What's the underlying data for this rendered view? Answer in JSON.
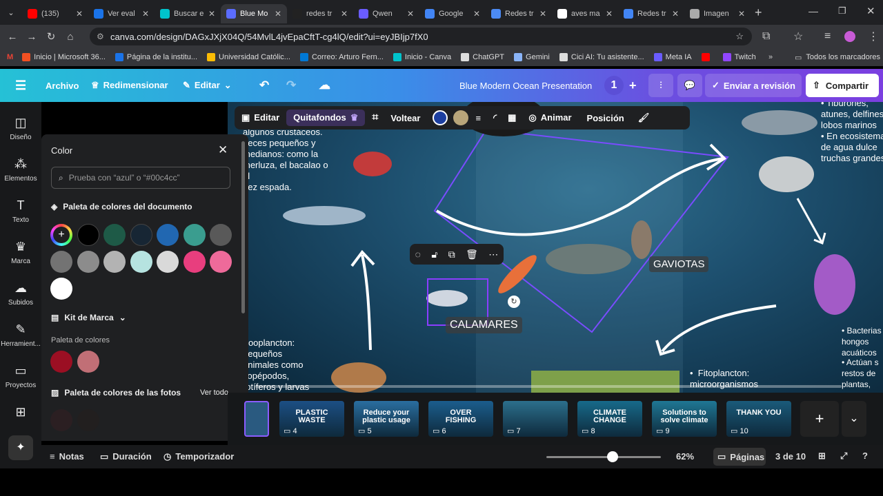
{
  "tabs": [
    {
      "label": "(135)",
      "color": "#ff0000"
    },
    {
      "label": "Ver eval",
      "color": "#1a73e8"
    },
    {
      "label": "Buscar e",
      "color": "#00c4cc"
    },
    {
      "label": "Blue Mo",
      "color": "#5b6cff"
    },
    {
      "label": "redes tr",
      "color": "#222"
    },
    {
      "label": "Qwen",
      "color": "#6a5cff"
    },
    {
      "label": "Google",
      "color": "#4285f4"
    },
    {
      "label": "Redes tr",
      "color": "#4c8bf5"
    },
    {
      "label": "aves ma",
      "color": "#fff"
    },
    {
      "label": "Redes tr",
      "color": "#4285f4"
    },
    {
      "label": "Imagen",
      "color": "#aaa"
    }
  ],
  "url": "canva.com/design/DAGxJXjX04Q/54MvlL4jvEpaCftT-cg4lQ/edit?ui=eyJBIjp7fX0",
  "bookmarks": [
    {
      "label": "Inicio | Microsoft 36...",
      "color": "#f25022"
    },
    {
      "label": "Página de la institu...",
      "color": "#1a73e8"
    },
    {
      "label": "Universidad Católic...",
      "color": "#fbbc05"
    },
    {
      "label": "Correo: Arturo Fern...",
      "color": "#0078d4"
    },
    {
      "label": "Inicio - Canva",
      "color": "#00c4cc"
    },
    {
      "label": "ChatGPT",
      "color": "#ddd"
    },
    {
      "label": "Gemini",
      "color": "#8ab4f8"
    },
    {
      "label": "Cici AI: Tu asistente...",
      "color": "#ddd"
    },
    {
      "label": "Meta IA",
      "color": "#6a5cff"
    },
    {
      "label": "",
      "color": "#ff0000"
    },
    {
      "label": "Twitch",
      "color": "#9146ff"
    }
  ],
  "bookmarks_all": "Todos los marcadores",
  "canva": {
    "archivo": "Archivo",
    "redimensionar": "Redimensionar",
    "editar": "Editar",
    "title": "Blue Modern Ocean Presentation",
    "collab_count": "1",
    "enviar": "Enviar a revisión",
    "compartir": "Compartir"
  },
  "sidebar": [
    {
      "label": "Diseño",
      "icon": "layout-icon"
    },
    {
      "label": "Elementos",
      "icon": "elements-icon"
    },
    {
      "label": "Texto",
      "icon": "text-icon"
    },
    {
      "label": "Marca",
      "icon": "brand-icon"
    },
    {
      "label": "Subidos",
      "icon": "upload-icon"
    },
    {
      "label": "Herramient...",
      "icon": "tools-icon"
    },
    {
      "label": "Proyectos",
      "icon": "folder-icon"
    }
  ],
  "color_panel": {
    "title": "Color",
    "search_placeholder": "Prueba con “azul” o “#00c4cc”",
    "doc_palette": "Paleta de colores del documento",
    "doc_colors": [
      "#000000",
      "#1e5a47",
      "#172634",
      "#2167b1",
      "#3a9d8f",
      "#595959",
      "#737373",
      "#8c8c8c",
      "#b3b3b3",
      "#b6e3e0",
      "#d9d9d9",
      "#e83e7e",
      "#ee6a9a",
      "#ffffff"
    ],
    "brand_kit": "Kit de Marca",
    "brand_palette": "Paleta de colores",
    "brand_colors": [
      "#9b0f23",
      "#c16f76"
    ],
    "photo_palette": "Paleta de colores de las fotos",
    "ver_todo": "Ver todo",
    "photo_colors": [
      "#2b1f22",
      "#221f1f"
    ]
  },
  "toolbar": {
    "editar": "Editar",
    "quitafondos": "Quitafondos",
    "voltear": "Voltear",
    "color1": "#1d3fa0",
    "color2": "#b8a57a",
    "animar": "Animar",
    "posicion": "Posición"
  },
  "slide": {
    "top_left_text": "algunos crustáceos.\npeces pequeños y\nmedianos: como la\nmerluza, el bacalao o el\npez espada.",
    "top_right_text": "Tiburones,\natunes, delfines\nlobos marinos",
    "right_text2": "En ecosistemas\nde agua dulce\ntruchas grandes",
    "gaviotas": "GAVIOTAS",
    "calamares": "CALAMARES",
    "zooplancton": "Zooplancton:\npequeños\nanimales como\ncopépodos,\nrotíferos y larvas",
    "fitoplancton": "Fitoplancton:\nmicroorganismos",
    "bacterias": "Bacterias\nhongos\nacuáticos",
    "actuan": "Actúan s\nrestos de\nplantas,"
  },
  "thumbs": [
    {
      "n": "4",
      "text": "PLASTIC WASTE",
      "bg": "#1c4f84"
    },
    {
      "n": "5",
      "text": "Reduce your plastic usage",
      "bg": "#2a6ea0"
    },
    {
      "n": "6",
      "text": "OVER FISHING",
      "bg": "#1b5d8d"
    },
    {
      "n": "7",
      "text": "",
      "bg": "#2c6f8c"
    },
    {
      "n": "8",
      "text": "CLIMATE CHANGE",
      "bg": "#176a8a"
    },
    {
      "n": "9",
      "text": "Solutions to solve climate",
      "bg": "#1f7794"
    },
    {
      "n": "10",
      "text": "THANK YOU",
      "bg": "#1a5a7a"
    }
  ],
  "bottom": {
    "notas": "Notas",
    "duracion": "Duración",
    "temporizador": "Temporizador",
    "zoom": "62%",
    "zoom_fraction": 0.62,
    "paginas": "Páginas",
    "page_of": "3 de 10"
  }
}
